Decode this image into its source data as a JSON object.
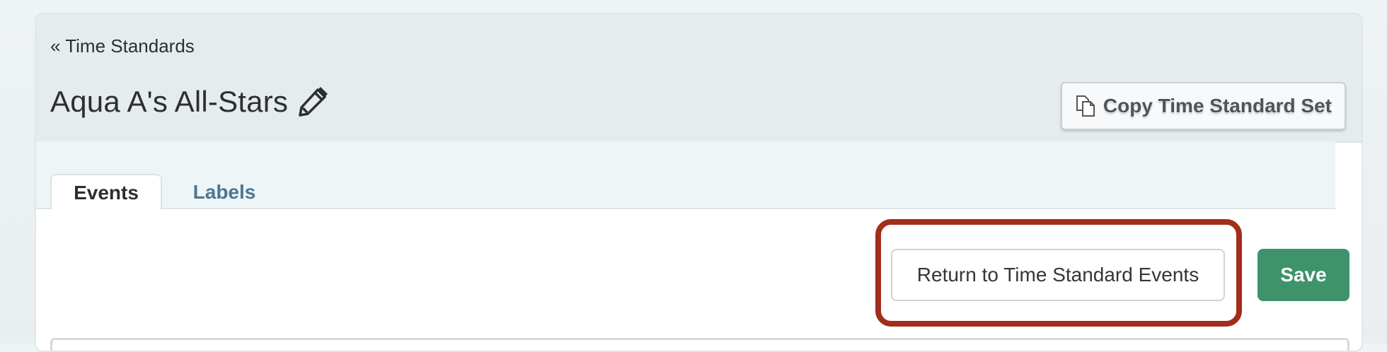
{
  "header": {
    "back_link": "« Time Standards",
    "title": "Aqua A's All-Stars",
    "edit_icon": "pencil-icon",
    "copy_button": {
      "label": "Copy Time Standard Set",
      "icon": "copy-icon"
    }
  },
  "tabs": [
    {
      "label": "Events",
      "active": true
    },
    {
      "label": "Labels",
      "active": false
    }
  ],
  "actions": {
    "return_label": "Return to Time Standard Events",
    "save_label": "Save"
  },
  "colors": {
    "save": "#3f936b",
    "highlight": "#a32d1c",
    "tab_inactive": "#4d7793"
  }
}
